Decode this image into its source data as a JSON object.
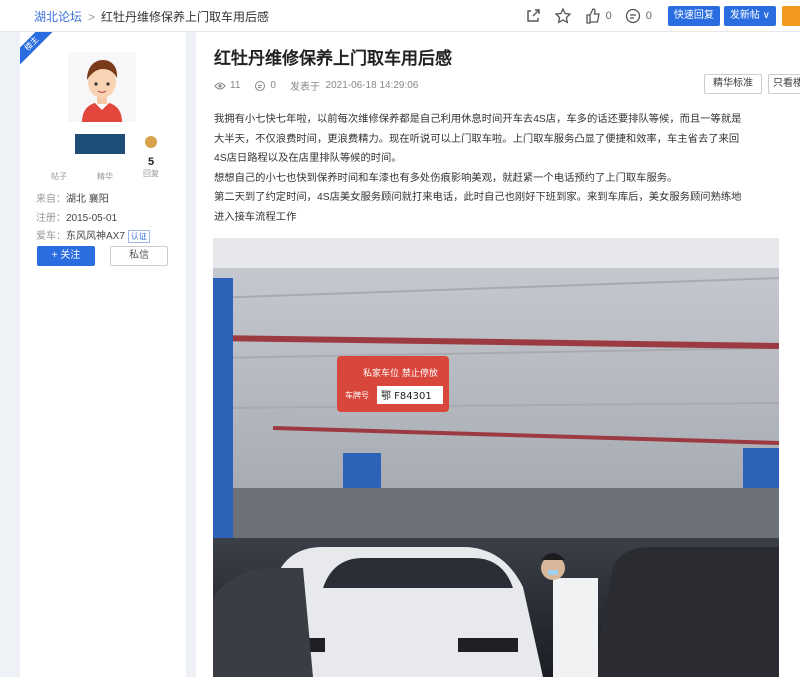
{
  "breadcrumb": {
    "forum": "湖北论坛",
    "separator": ">",
    "current": "红牡丹维修保养上门取车用后感"
  },
  "toolbar": {
    "like_count": "0",
    "comment_count": "0",
    "quick_reply": "快速回复",
    "post_menu": "发新帖"
  },
  "user": {
    "ribbon": "楼主",
    "stats": [
      {
        "num": "",
        "label": "帖子"
      },
      {
        "num": "",
        "label": "精华"
      },
      {
        "num": "5",
        "label": "回复"
      }
    ],
    "from_label": "来自：",
    "from_value": "湖北 襄阳",
    "reg_label": "注册：",
    "reg_value": "2015-05-01",
    "car_label": "爱车：",
    "car_value": "东风风神AX7",
    "car_tag": "认证",
    "follow_button": "+ 关注",
    "message_button": "私信"
  },
  "post": {
    "title": "红牡丹维修保养上门取车用后感",
    "views": "11",
    "comments": "0",
    "published_label": "发表于",
    "published_time": "2021-06-18 14:29:06",
    "btn_standard": "精华标准",
    "btn_author": "只看楼",
    "paragraphs": [
      "我拥有小七快七年啦，以前每次维修保养都是自己利用休息时间开车去4S店，车多的话还要排队等候，而且一等就是",
      "大半天，不仅浪费时间，更浪费精力。现在听说可以上门取车啦。上门取车服务凸显了便捷和效率，车主省去了来回",
      "4S店日路程以及在店里排队等候的时间。",
      "想想自己的小七也快到保养时间和车漆也有多处伤痕影响美观，就赶紧一个电话预约了上门取车服务。",
      "第二天到了约定时间，4S店美女服务顾问就打来电话，此时自己也刚好下班到家。来到车库后，美女服务顾问熟练地",
      "进入接车流程工作"
    ],
    "photo_sign_title": "私家车位 禁止停放",
    "photo_sign_label": "车牌号",
    "photo_sign_plate": "鄂 F84301"
  },
  "colors": {
    "accent": "#2a6de0",
    "orange": "#f39a1e"
  }
}
